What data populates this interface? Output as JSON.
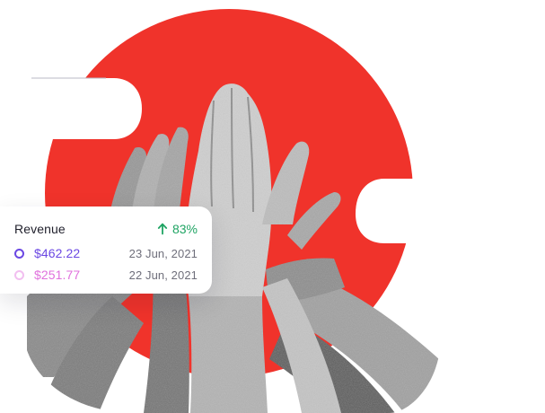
{
  "colors": {
    "accent_red": "#f0332b",
    "growth_green": "#1fa463",
    "primary_purple": "#6b48e3",
    "secondary_pink": "#e071dd",
    "secondary_pink_light": "#f2bff0"
  },
  "revenue_card": {
    "title": "Revenue",
    "growth_icon": "arrow-up-icon",
    "growth": "83%",
    "entries": [
      {
        "amount": "$462.22",
        "date": "23 Jun, 2021",
        "dot_icon": "ring-dot-icon"
      },
      {
        "amount": "$251.77",
        "date": "22 Jun, 2021",
        "dot_icon": "ring-dot-icon"
      }
    ]
  }
}
